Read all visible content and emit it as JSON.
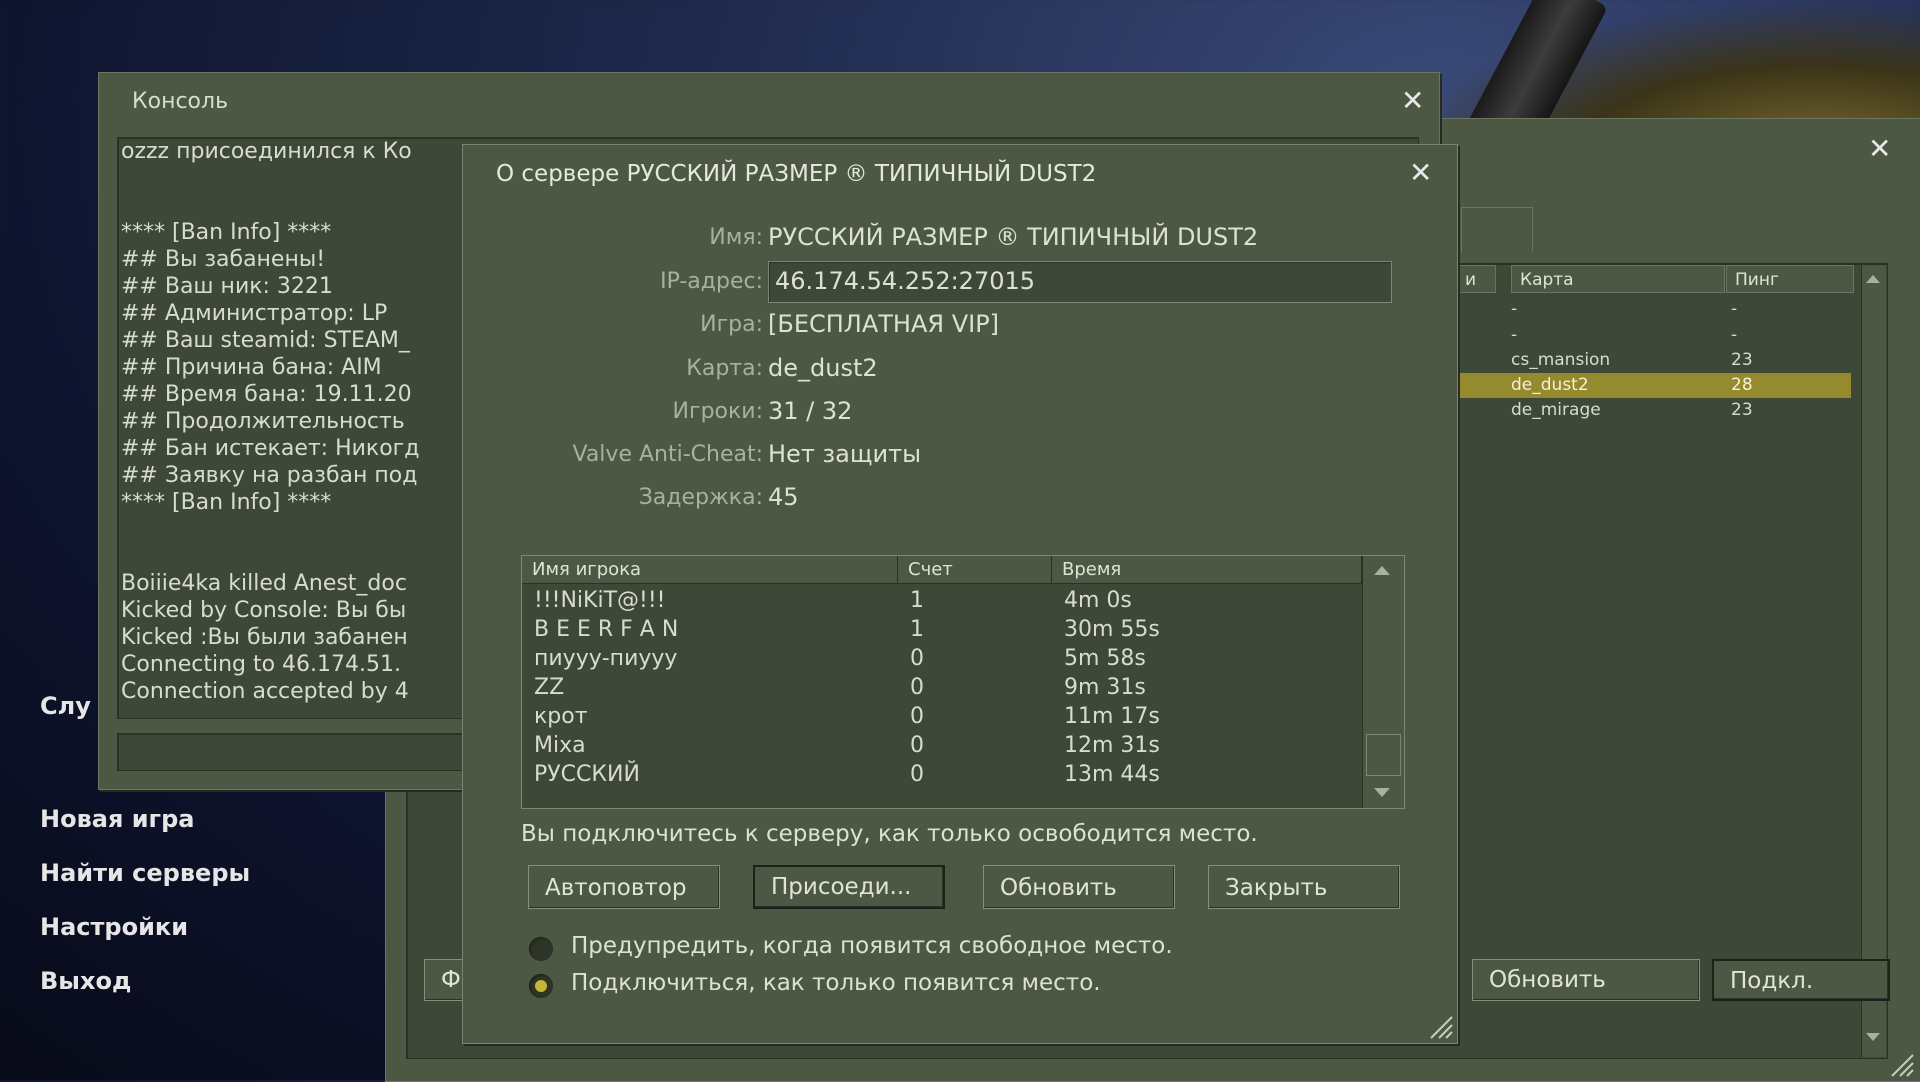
{
  "main_menu": {
    "partial_item": "Слу",
    "items": [
      "Новая игра",
      "Найти серверы",
      "Настройки",
      "Выход"
    ]
  },
  "browser": {
    "columns": {
      "col_partial": "и",
      "map": "Карта",
      "ping": "Пинг"
    },
    "rows": [
      {
        "map": "-",
        "ping": "-",
        "selected": false
      },
      {
        "map": "-",
        "ping": "-",
        "selected": false
      },
      {
        "map": "cs_mansion",
        "ping": "23",
        "selected": false
      },
      {
        "map": "de_dust2",
        "ping": "28",
        "selected": true
      },
      {
        "map": "de_mirage",
        "ping": "23",
        "selected": false
      }
    ],
    "left_btn_partial": "Ф",
    "refresh_label": "Обновить",
    "connect_label": "Подкл."
  },
  "console": {
    "title": "Консоль",
    "lines": [
      "ozzz присоединился к Ко",
      "",
      "",
      "**** [Ban Info] ****",
      "## Вы забанены!",
      "## Ваш ник: 3221",
      "## Администратор: LP",
      "## Ваш steamid: STEAM_",
      "## Причина бана: AIM",
      "## Время бана: 19.11.20",
      "## Продолжительность",
      "## Бан истекает: Никогд",
      "## Заявку на разбан под",
      "**** [Ban Info] ****",
      "",
      "",
      "Boiiie4ka killed Anest_doc",
      "Kicked by Console: Вы бы",
      "Kicked :Вы были забанен",
      "Connecting to 46.174.51.",
      "Connection accepted by 4"
    ]
  },
  "dialog": {
    "title": "О сервере РУССКИЙ РАЗМЕР ® ТИПИЧНЫЙ DUST2",
    "fields": {
      "name_label": "Имя:",
      "name": "РУССКИЙ РАЗМЕР ® ТИПИЧНЫЙ DUST2",
      "ip_label": "IP-адрес:",
      "ip": "46.174.54.252:27015",
      "game_label": "Игра:",
      "game": "[БЕСПЛАТНАЯ VIP]",
      "map_label": "Карта:",
      "map": "de_dust2",
      "players_label": "Игроки:",
      "players": "31 / 32",
      "vac_label": "Valve Anti-Cheat:",
      "vac": "Нет защиты",
      "ping_label": "Задержка:",
      "ping": "45"
    },
    "table": {
      "headers": {
        "name": "Имя игрока",
        "score": "Счет",
        "time": "Время"
      },
      "rows": [
        {
          "name": "!!!NiKiT@!!!",
          "score": "1",
          "time": "4m 0s"
        },
        {
          "name": "B E E R F A N",
          "score": "1",
          "time": "30m 55s"
        },
        {
          "name": "пиууу-пиууу",
          "score": "0",
          "time": "5m 58s"
        },
        {
          "name": "ZZ",
          "score": "0",
          "time": "9m 31s"
        },
        {
          "name": "крот",
          "score": "0",
          "time": "11m 17s"
        },
        {
          "name": "Mixa",
          "score": "0",
          "time": "12m 31s"
        },
        {
          "name": "РУССКИЙ",
          "score": "0",
          "time": "13m 44s"
        }
      ]
    },
    "notice": "Вы подключитесь к серверу, как только освободится место.",
    "buttons": {
      "auto": "Автоповтор",
      "join": "Присоеди...",
      "refresh": "Обновить",
      "close": "Закрыть"
    },
    "radio": {
      "warn": "Предупредить, когда появится свободное место.",
      "connect": "Подключиться, как только появится место.",
      "selected": "connect"
    }
  },
  "colors": {
    "window_bg": "#4c5844",
    "selected_row": "#958a2e",
    "radio_on": "#c7b63a"
  }
}
